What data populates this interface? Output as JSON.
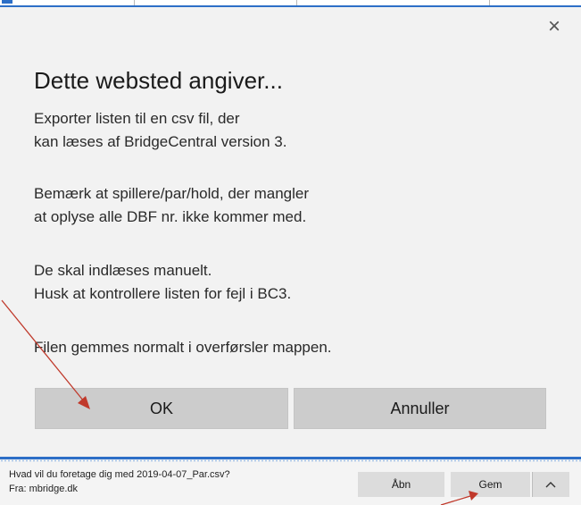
{
  "dialog": {
    "title": "Dette websted angiver...",
    "close_glyph": "×",
    "lines": [
      "Exporter listen til en csv fil, der",
      "kan læses af BridgeCentral version 3.",
      "Bemærk at spillere/par/hold, der mangler",
      "at oplyse alle DBF nr. ikke kommer med.",
      "De skal indlæses manuelt.",
      "Husk at kontrollere listen for fejl i BC3.",
      "Filen gemmes normalt i overførsler mappen."
    ],
    "ok_label": "OK",
    "cancel_label": "Annuller"
  },
  "download_bar": {
    "question": "Hvad vil du foretage dig med 2019-04-07_Par.csv?",
    "from": "Fra: mbridge.dk",
    "open_label": "Åbn",
    "save_label": "Gem",
    "more_icon": "chevron-up-icon"
  },
  "colors": {
    "accent": "#2d6fc7",
    "annotation_arrow": "#c0392b",
    "button_bg": "#cccccc",
    "dialog_bg": "#f2f2f2"
  }
}
